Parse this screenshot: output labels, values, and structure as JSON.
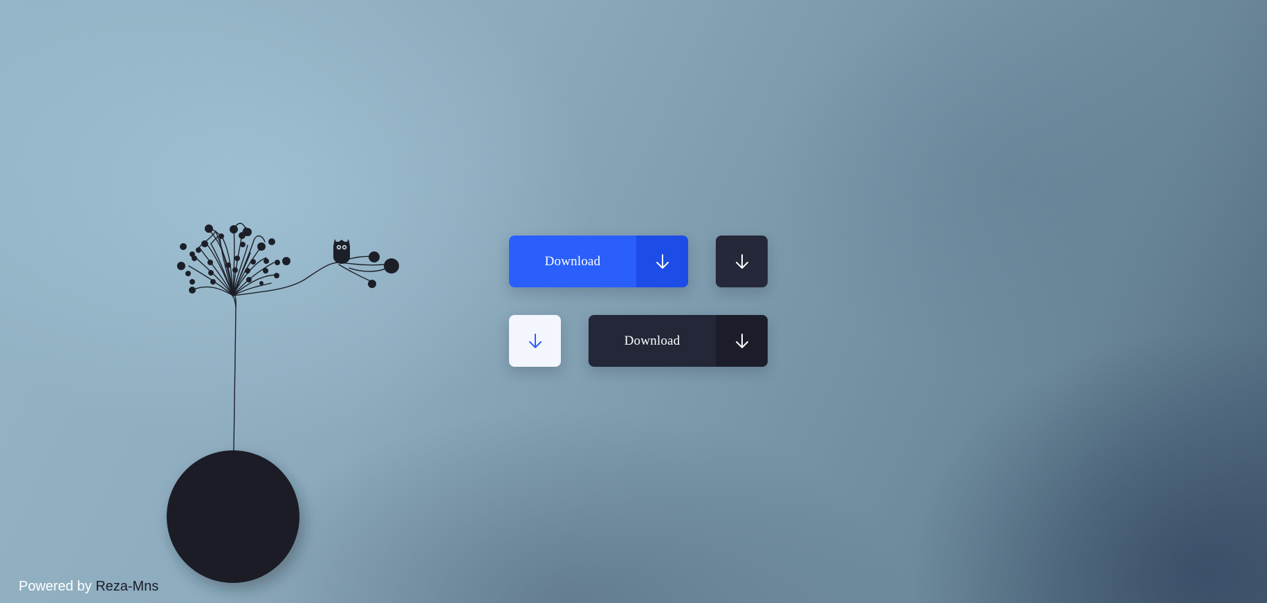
{
  "buttons": {
    "primary_label": "Download",
    "secondary_label": "Download"
  },
  "icons": {
    "download": "arrow-down-icon"
  },
  "credit": {
    "prefix": "Powered by",
    "author": "Reza-Mns"
  },
  "colors": {
    "accent_blue": "#2a5ffc",
    "accent_blue_dark": "#1d4ce6",
    "dark_button": "#232737",
    "dark_button_side": "#1b1e2a",
    "light_button": "#f3f6fd",
    "ink": "#1c1f28"
  }
}
